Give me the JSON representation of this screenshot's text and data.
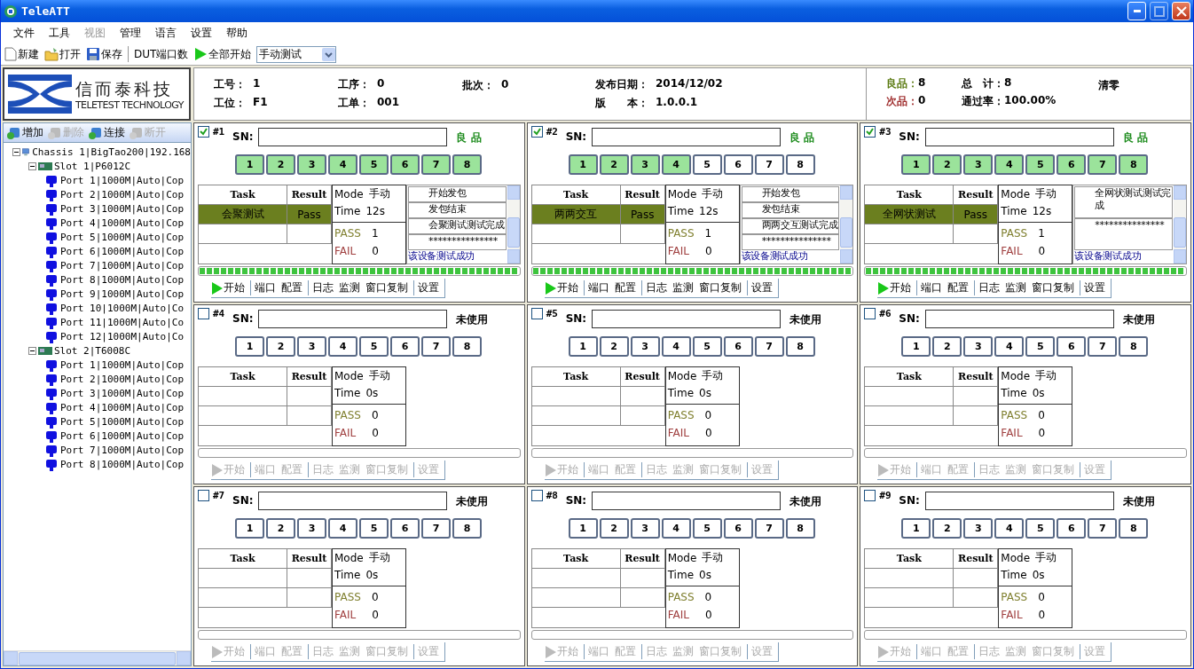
{
  "window": {
    "title": "TeleATT",
    "maximize_disabled": true
  },
  "menu": [
    {
      "label": "文件",
      "disabled": false
    },
    {
      "label": "工具",
      "disabled": false
    },
    {
      "label": "视图",
      "disabled": true
    },
    {
      "label": "管理",
      "disabled": false
    },
    {
      "label": "语言",
      "disabled": false
    },
    {
      "label": "设置",
      "disabled": false
    },
    {
      "label": "帮助",
      "disabled": false
    }
  ],
  "toolbar": [
    {
      "kind": "new",
      "label": "新建"
    },
    {
      "kind": "open",
      "label": "打开"
    },
    {
      "kind": "save",
      "label": "保存"
    },
    {
      "kind": "separator"
    },
    {
      "kind": "text",
      "label": "DUT端口数"
    },
    {
      "kind": "start",
      "label": "全部开始"
    },
    {
      "kind": "select",
      "value": "手动测试"
    }
  ],
  "logo": {
    "name": "信而泰科技",
    "subtitle": "TELETEST TECHNOLOGY"
  },
  "info": [
    [
      {
        "label": "工号：",
        "value": "1"
      },
      {
        "label": "工位：",
        "value": "F1"
      }
    ],
    [
      {
        "label": "工序：",
        "value": "0"
      },
      {
        "label": "工单：",
        "value": "001"
      }
    ],
    [
      {
        "label": "批次：",
        "value": "0"
      }
    ],
    [
      {
        "label": "发布日期：",
        "value": "2014/12/02"
      },
      {
        "label": "版　　本：",
        "value": "1.0.0.1"
      }
    ]
  ],
  "stats": {
    "good_label": "良品：",
    "good": "8",
    "bad_label": "次品：",
    "bad": "0",
    "total_label": "总　计：",
    "total": "8",
    "rate_label": "通过率：",
    "rate": "100.00%",
    "reset": "清零"
  },
  "device_toolbar": [
    {
      "label": "增加",
      "disabled": false
    },
    {
      "label": "删除",
      "disabled": true
    },
    {
      "label": "连接",
      "disabled": false
    },
    {
      "label": "断开",
      "disabled": true
    }
  ],
  "tree": [
    {
      "kind": "chassis",
      "label": "Chassis 1|BigTao200|192.168",
      "expanded": true,
      "children": [
        {
          "kind": "slot",
          "label": "Slot 1|P6012C",
          "expanded": true,
          "children": [
            {
              "kind": "port",
              "label": "Port 1|1000M|Auto|Cop"
            },
            {
              "kind": "port",
              "label": "Port 2|1000M|Auto|Cop"
            },
            {
              "kind": "port",
              "label": "Port 3|1000M|Auto|Cop"
            },
            {
              "kind": "port",
              "label": "Port 4|1000M|Auto|Cop"
            },
            {
              "kind": "port",
              "label": "Port 5|1000M|Auto|Cop"
            },
            {
              "kind": "port",
              "label": "Port 6|1000M|Auto|Cop"
            },
            {
              "kind": "port",
              "label": "Port 7|1000M|Auto|Cop"
            },
            {
              "kind": "port",
              "label": "Port 8|1000M|Auto|Cop"
            },
            {
              "kind": "port",
              "label": "Port 9|1000M|Auto|Cop"
            },
            {
              "kind": "port",
              "label": "Port 10|1000M|Auto|Co"
            },
            {
              "kind": "port",
              "label": "Port 11|1000M|Auto|Co"
            },
            {
              "kind": "port",
              "label": "Port 12|1000M|Auto|Co"
            }
          ]
        },
        {
          "kind": "slot",
          "label": "Slot 2|T6008C",
          "expanded": true,
          "children": [
            {
              "kind": "port",
              "label": "Port 1|1000M|Auto|Cop"
            },
            {
              "kind": "port",
              "label": "Port 2|1000M|Auto|Cop"
            },
            {
              "kind": "port",
              "label": "Port 3|1000M|Auto|Cop"
            },
            {
              "kind": "port",
              "label": "Port 4|1000M|Auto|Cop"
            },
            {
              "kind": "port",
              "label": "Port 5|1000M|Auto|Cop"
            },
            {
              "kind": "port",
              "label": "Port 6|1000M|Auto|Cop"
            },
            {
              "kind": "port",
              "label": "Port 7|1000M|Auto|Cop"
            },
            {
              "kind": "port",
              "label": "Port 8|1000M|Auto|Cop"
            }
          ]
        }
      ]
    }
  ],
  "panels": [
    {
      "number": "#1",
      "checked": true,
      "sn_label": "SN:",
      "status": "良 品",
      "color": "#1a8a1a",
      "ports": [
        {
          "label": "1",
          "on": true
        },
        {
          "label": "2",
          "on": true
        },
        {
          "label": "3",
          "on": true
        },
        {
          "label": "4",
          "on": true
        },
        {
          "label": "5",
          "on": true
        },
        {
          "label": "6",
          "on": true
        },
        {
          "label": "7",
          "on": true
        },
        {
          "label": "8",
          "on": true
        }
      ],
      "columns": [
        "Task",
        "Result"
      ],
      "tasks": [
        {
          "task": "会聚测试",
          "result": "Pass",
          "selected": true
        }
      ],
      "mode_label": "Mode",
      "mode": "手动",
      "time_label": "Time",
      "time": "12s",
      "pass_label": "PASS",
      "pass": "1",
      "fail_label": "FAIL",
      "fail": "0",
      "log": [
        {
          "text": "开始发包",
          "kind": "info"
        },
        {
          "text": "发包结束",
          "kind": "info"
        },
        {
          "text": "会聚测试测试完成",
          "kind": "info"
        },
        {
          "text": "***************",
          "kind": "info"
        },
        {
          "text": "该设备测试成功",
          "kind": "success"
        }
      ],
      "progress": {
        "level": 1
      },
      "actions_disabled": false,
      "actions": [
        {
          "label": "开始",
          "kind": "start"
        },
        {
          "label": "端口",
          "kind": "group"
        },
        {
          "label": "配置",
          "kind": "item"
        },
        {
          "label": "日志",
          "kind": "group"
        },
        {
          "label": "监测",
          "kind": "item"
        },
        {
          "label": "窗口复制",
          "kind": "item"
        },
        {
          "label": "设置",
          "kind": "group"
        }
      ]
    },
    {
      "number": "#2",
      "checked": true,
      "sn_label": "SN:",
      "status": "良 品",
      "color": "#1a8a1a",
      "ports": [
        {
          "label": "1",
          "on": true
        },
        {
          "label": "2",
          "on": true
        },
        {
          "label": "3",
          "on": true
        },
        {
          "label": "4",
          "on": true
        },
        {
          "label": "5",
          "on": false
        },
        {
          "label": "6",
          "on": false
        },
        {
          "label": "7",
          "on": false
        },
        {
          "label": "8",
          "on": false
        }
      ],
      "columns": [
        "Task",
        "Result"
      ],
      "tasks": [
        {
          "task": "两两交互",
          "result": "Pass",
          "selected": true
        }
      ],
      "mode_label": "Mode",
      "mode": "手动",
      "time_label": "Time",
      "time": "12s",
      "pass_label": "PASS",
      "pass": "1",
      "fail_label": "FAIL",
      "fail": "0",
      "log": [
        {
          "text": "开始发包",
          "kind": "info"
        },
        {
          "text": "发包结束",
          "kind": "info"
        },
        {
          "text": "两两交互测试完成",
          "kind": "info"
        },
        {
          "text": "***************",
          "kind": "info"
        },
        {
          "text": "该设备测试成功",
          "kind": "success"
        }
      ],
      "progress": {
        "level": 1
      },
      "actions_disabled": false,
      "actions": [
        {
          "label": "开始",
          "kind": "start"
        },
        {
          "label": "端口",
          "kind": "group"
        },
        {
          "label": "配置",
          "kind": "item"
        },
        {
          "label": "日志",
          "kind": "group"
        },
        {
          "label": "监测",
          "kind": "item"
        },
        {
          "label": "窗口复制",
          "kind": "item"
        },
        {
          "label": "设置",
          "kind": "group"
        }
      ]
    },
    {
      "number": "#3",
      "checked": true,
      "sn_label": "SN:",
      "status": "良 品",
      "color": "#1a8a1a",
      "ports": [
        {
          "label": "1",
          "on": true
        },
        {
          "label": "2",
          "on": true
        },
        {
          "label": "3",
          "on": true
        },
        {
          "label": "4",
          "on": true
        },
        {
          "label": "5",
          "on": true
        },
        {
          "label": "6",
          "on": true
        },
        {
          "label": "7",
          "on": true
        },
        {
          "label": "8",
          "on": true
        }
      ],
      "columns": [
        "Task",
        "Result"
      ],
      "tasks": [
        {
          "task": "全网状测试",
          "result": "Pass",
          "selected": true
        }
      ],
      "mode_label": "Mode",
      "mode": "手动",
      "time_label": "Time",
      "time": "12s",
      "pass_label": "PASS",
      "pass": "1",
      "fail_label": "FAIL",
      "fail": "0",
      "log": [
        {
          "text": "全网状测试测试完成",
          "kind": "info"
        },
        {
          "text": "***************",
          "kind": "info"
        },
        {
          "text": "该设备测试成功",
          "kind": "success"
        }
      ],
      "progress": {
        "level": 1
      },
      "actions_disabled": false,
      "actions": [
        {
          "label": "开始",
          "kind": "start"
        },
        {
          "label": "端口",
          "kind": "group"
        },
        {
          "label": "配置",
          "kind": "item"
        },
        {
          "label": "日志",
          "kind": "group"
        },
        {
          "label": "监测",
          "kind": "item"
        },
        {
          "label": "窗口复制",
          "kind": "item"
        },
        {
          "label": "设置",
          "kind": "group"
        }
      ]
    },
    {
      "number": "#4",
      "checked": false,
      "sn_label": "SN:",
      "status": "未使用",
      "color": "#000000",
      "ports": [
        {
          "label": "1",
          "on": false
        },
        {
          "label": "2",
          "on": false
        },
        {
          "label": "3",
          "on": false
        },
        {
          "label": "4",
          "on": false
        },
        {
          "label": "5",
          "on": false
        },
        {
          "label": "6",
          "on": false
        },
        {
          "label": "7",
          "on": false
        },
        {
          "label": "8",
          "on": false
        }
      ],
      "columns": [
        "Task",
        "Result"
      ],
      "mode_label": "Mode",
      "mode": "手动",
      "time_label": "Time",
      "time": "0s",
      "pass_label": "PASS",
      "pass": "0",
      "fail_label": "FAIL",
      "fail": "0",
      "progress": {
        "level": 0
      },
      "actions_disabled": true,
      "actions": [
        {
          "label": "开始",
          "kind": "start"
        },
        {
          "label": "端口",
          "kind": "group"
        },
        {
          "label": "配置",
          "kind": "item"
        },
        {
          "label": "日志",
          "kind": "group"
        },
        {
          "label": "监测",
          "kind": "item"
        },
        {
          "label": "窗口复制",
          "kind": "item"
        },
        {
          "label": "设置",
          "kind": "group"
        }
      ]
    },
    {
      "number": "#5",
      "checked": false,
      "sn_label": "SN:",
      "status": "未使用",
      "color": "#000000",
      "ports": [
        {
          "label": "1",
          "on": false
        },
        {
          "label": "2",
          "on": false
        },
        {
          "label": "3",
          "on": false
        },
        {
          "label": "4",
          "on": false
        },
        {
          "label": "5",
          "on": false
        },
        {
          "label": "6",
          "on": false
        },
        {
          "label": "7",
          "on": false
        },
        {
          "label": "8",
          "on": false
        }
      ],
      "columns": [
        "Task",
        "Result"
      ],
      "mode_label": "Mode",
      "mode": "手动",
      "time_label": "Time",
      "time": "0s",
      "pass_label": "PASS",
      "pass": "0",
      "fail_label": "FAIL",
      "fail": "0",
      "progress": {
        "level": 0
      },
      "actions_disabled": true,
      "actions": [
        {
          "label": "开始",
          "kind": "start"
        },
        {
          "label": "端口",
          "kind": "group"
        },
        {
          "label": "配置",
          "kind": "item"
        },
        {
          "label": "日志",
          "kind": "group"
        },
        {
          "label": "监测",
          "kind": "item"
        },
        {
          "label": "窗口复制",
          "kind": "item"
        },
        {
          "label": "设置",
          "kind": "group"
        }
      ]
    },
    {
      "number": "#6",
      "checked": false,
      "sn_label": "SN:",
      "status": "未使用",
      "color": "#000000",
      "ports": [
        {
          "label": "1",
          "on": false
        },
        {
          "label": "2",
          "on": false
        },
        {
          "label": "3",
          "on": false
        },
        {
          "label": "4",
          "on": false
        },
        {
          "label": "5",
          "on": false
        },
        {
          "label": "6",
          "on": false
        },
        {
          "label": "7",
          "on": false
        },
        {
          "label": "8",
          "on": false
        }
      ],
      "columns": [
        "Task",
        "Result"
      ],
      "mode_label": "Mode",
      "mode": "手动",
      "time_label": "Time",
      "time": "0s",
      "pass_label": "PASS",
      "pass": "0",
      "fail_label": "FAIL",
      "fail": "0",
      "progress": {
        "level": 0
      },
      "actions_disabled": true,
      "actions": [
        {
          "label": "开始",
          "kind": "start"
        },
        {
          "label": "端口",
          "kind": "group"
        },
        {
          "label": "配置",
          "kind": "item"
        },
        {
          "label": "日志",
          "kind": "group"
        },
        {
          "label": "监测",
          "kind": "item"
        },
        {
          "label": "窗口复制",
          "kind": "item"
        },
        {
          "label": "设置",
          "kind": "group"
        }
      ]
    },
    {
      "number": "#7",
      "checked": false,
      "sn_label": "SN:",
      "status": "未使用",
      "color": "#000000",
      "ports": [
        {
          "label": "1",
          "on": false
        },
        {
          "label": "2",
          "on": false
        },
        {
          "label": "3",
          "on": false
        },
        {
          "label": "4",
          "on": false
        },
        {
          "label": "5",
          "on": false
        },
        {
          "label": "6",
          "on": false
        },
        {
          "label": "7",
          "on": false
        },
        {
          "label": "8",
          "on": false
        }
      ],
      "columns": [
        "Task",
        "Result"
      ],
      "mode_label": "Mode",
      "mode": "手动",
      "time_label": "Time",
      "time": "0s",
      "pass_label": "PASS",
      "pass": "0",
      "fail_label": "FAIL",
      "fail": "0",
      "progress": {
        "level": 0
      },
      "actions_disabled": true,
      "actions": [
        {
          "label": "开始",
          "kind": "start"
        },
        {
          "label": "端口",
          "kind": "group"
        },
        {
          "label": "配置",
          "kind": "item"
        },
        {
          "label": "日志",
          "kind": "group"
        },
        {
          "label": "监测",
          "kind": "item"
        },
        {
          "label": "窗口复制",
          "kind": "item"
        },
        {
          "label": "设置",
          "kind": "group"
        }
      ]
    },
    {
      "number": "#8",
      "checked": false,
      "sn_label": "SN:",
      "status": "未使用",
      "color": "#000000",
      "ports": [
        {
          "label": "1",
          "on": false
        },
        {
          "label": "2",
          "on": false
        },
        {
          "label": "3",
          "on": false
        },
        {
          "label": "4",
          "on": false
        },
        {
          "label": "5",
          "on": false
        },
        {
          "label": "6",
          "on": false
        },
        {
          "label": "7",
          "on": false
        },
        {
          "label": "8",
          "on": false
        }
      ],
      "columns": [
        "Task",
        "Result"
      ],
      "mode_label": "Mode",
      "mode": "手动",
      "time_label": "Time",
      "time": "0s",
      "pass_label": "PASS",
      "pass": "0",
      "fail_label": "FAIL",
      "fail": "0",
      "progress": {
        "level": 0
      },
      "actions_disabled": true,
      "actions": [
        {
          "label": "开始",
          "kind": "start"
        },
        {
          "label": "端口",
          "kind": "group"
        },
        {
          "label": "配置",
          "kind": "item"
        },
        {
          "label": "日志",
          "kind": "group"
        },
        {
          "label": "监测",
          "kind": "item"
        },
        {
          "label": "窗口复制",
          "kind": "item"
        },
        {
          "label": "设置",
          "kind": "group"
        }
      ]
    },
    {
      "number": "#9",
      "checked": false,
      "sn_label": "SN:",
      "status": "未使用",
      "color": "#000000",
      "ports": [
        {
          "label": "1",
          "on": false
        },
        {
          "label": "2",
          "on": false
        },
        {
          "label": "3",
          "on": false
        },
        {
          "label": "4",
          "on": false
        },
        {
          "label": "5",
          "on": false
        },
        {
          "label": "6",
          "on": false
        },
        {
          "label": "7",
          "on": false
        },
        {
          "label": "8",
          "on": false
        }
      ],
      "columns": [
        "Task",
        "Result"
      ],
      "mode_label": "Mode",
      "mode": "手动",
      "time_label": "Time",
      "time": "0s",
      "pass_label": "PASS",
      "pass": "0",
      "fail_label": "FAIL",
      "fail": "0",
      "progress": {
        "level": 0
      },
      "actions_disabled": true,
      "actions": [
        {
          "label": "开始",
          "kind": "start"
        },
        {
          "label": "端口",
          "kind": "group"
        },
        {
          "label": "配置",
          "kind": "item"
        },
        {
          "label": "日志",
          "kind": "group"
        },
        {
          "label": "监测",
          "kind": "item"
        },
        {
          "label": "窗口复制",
          "kind": "item"
        },
        {
          "label": "设置",
          "kind": "group"
        }
      ]
    }
  ]
}
